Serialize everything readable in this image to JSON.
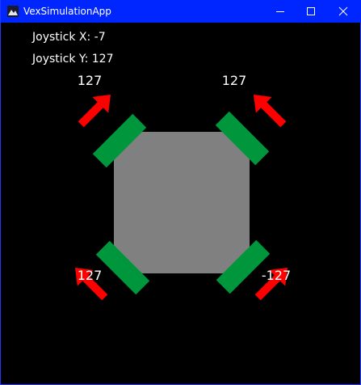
{
  "window": {
    "title": "VexSimulationApp",
    "icons": {
      "app": "app-icon",
      "minimize": "minimize-icon",
      "maximize": "maximize-icon",
      "close": "close-icon"
    }
  },
  "readouts": {
    "joystick_x": "Joystick X: -7",
    "joystick_y": "Joystick Y: 127"
  },
  "wheels": {
    "front_left": {
      "value": "127",
      "arrow": "forward"
    },
    "front_right": {
      "value": "127",
      "arrow": "forward"
    },
    "back_left": {
      "value": "127",
      "arrow": "forward"
    },
    "back_right": {
      "value": "-127",
      "arrow": "reverse"
    }
  },
  "colors": {
    "titlebar": "#0026ff",
    "background": "#000000",
    "chassis": "#808080",
    "wheel": "#00963c",
    "arrow": "#ff0000",
    "text": "#ffffff"
  }
}
